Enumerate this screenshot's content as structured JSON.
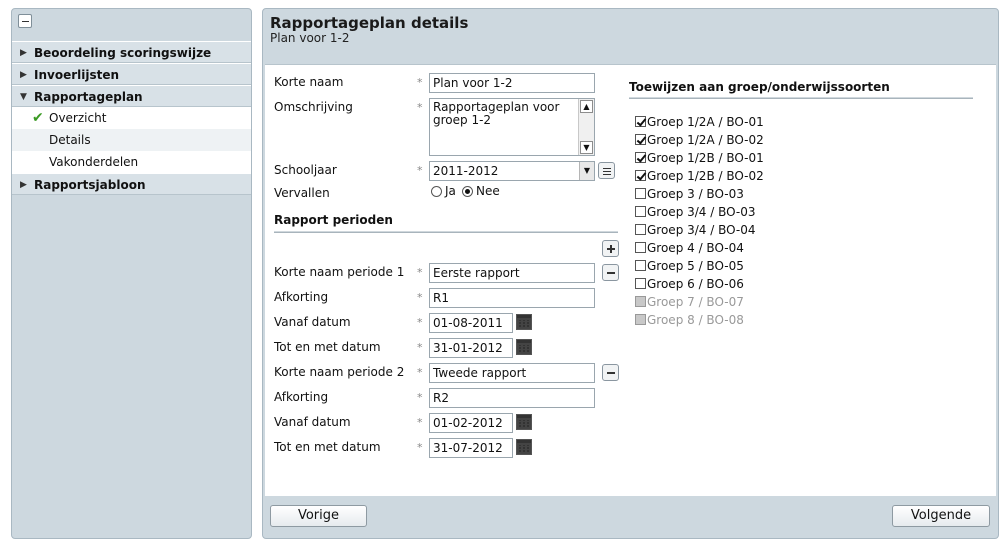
{
  "sidebar": {
    "items": [
      {
        "label": "Beoordeling scoringswijze"
      },
      {
        "label": "Invoerlijsten"
      },
      {
        "label": "Rapportageplan"
      },
      {
        "label": "Rapportsjabloon"
      }
    ],
    "subitems": [
      {
        "label": "Overzicht"
      },
      {
        "label": "Details"
      },
      {
        "label": "Vakonderdelen"
      }
    ]
  },
  "header": {
    "title": "Rapportageplan details",
    "subtitle": "Plan voor 1-2"
  },
  "form": {
    "korte_naam_label": "Korte naam",
    "korte_naam_value": "Plan voor 1-2",
    "omschrijving_label": "Omschrijving",
    "omschrijving_line1": "Rapportageplan voor",
    "omschrijving_line2": "groep 1-2",
    "schooljaar_label": "Schooljaar",
    "schooljaar_value": "2011-2012",
    "vervallen_label": "Vervallen",
    "ja_label": "Ja",
    "nee_label": "Nee",
    "required_mark": "*"
  },
  "periods": {
    "section_title": "Rapport perioden",
    "list": [
      {
        "name_label": "Korte naam periode 1",
        "name": "Eerste rapport",
        "afk_label": "Afkorting",
        "afk": "R1",
        "from_label": "Vanaf datum",
        "from": "01-08-2011",
        "to_label": "Tot en met datum",
        "to": "31-01-2012"
      },
      {
        "name_label": "Korte naam periode 2",
        "name": "Tweede rapport",
        "afk_label": "Afkorting",
        "afk": "R2",
        "from_label": "Vanaf datum",
        "from": "01-02-2012",
        "to_label": "Tot en met datum",
        "to": "31-07-2012"
      }
    ]
  },
  "groups": {
    "title": "Toewijzen aan groep/onderwijssoorten",
    "items": [
      {
        "label": "Groep 1/2A / BO-01",
        "checked": true,
        "disabled": false
      },
      {
        "label": "Groep 1/2A / BO-02",
        "checked": true,
        "disabled": false
      },
      {
        "label": "Groep 1/2B / BO-01",
        "checked": true,
        "disabled": false
      },
      {
        "label": "Groep 1/2B / BO-02",
        "checked": true,
        "disabled": false
      },
      {
        "label": "Groep 3 / BO-03",
        "checked": false,
        "disabled": false
      },
      {
        "label": "Groep 3/4 / BO-03",
        "checked": false,
        "disabled": false
      },
      {
        "label": "Groep 3/4 / BO-04",
        "checked": false,
        "disabled": false
      },
      {
        "label": "Groep 4 / BO-04",
        "checked": false,
        "disabled": false
      },
      {
        "label": "Groep 5 / BO-05",
        "checked": false,
        "disabled": false
      },
      {
        "label": "Groep 6 / BO-06",
        "checked": false,
        "disabled": false
      },
      {
        "label": "Groep 7 / BO-07",
        "checked": false,
        "disabled": true
      },
      {
        "label": "Groep 8 / BO-08",
        "checked": false,
        "disabled": true
      }
    ]
  },
  "footer": {
    "prev_label": "Vorige",
    "next_label": "Volgende"
  }
}
